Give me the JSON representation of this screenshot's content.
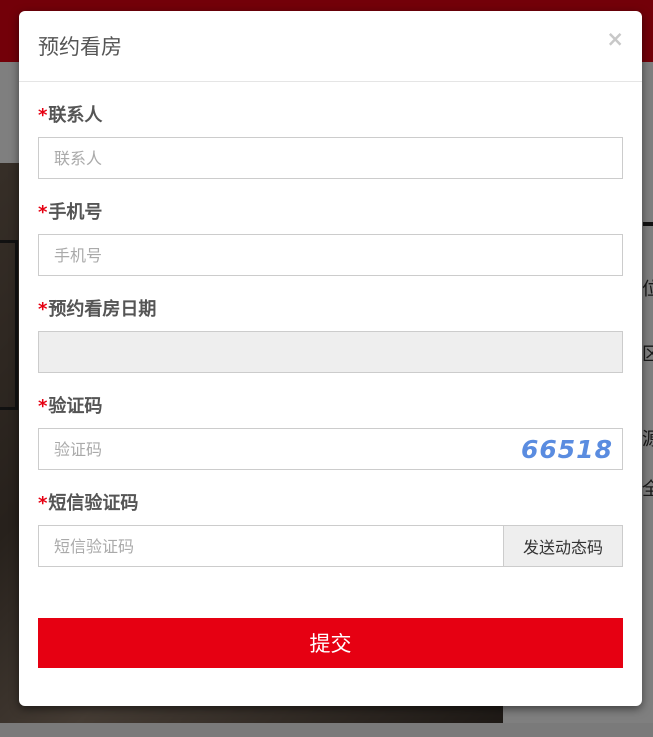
{
  "modal": {
    "title": "预约看房",
    "close_glyph": "×"
  },
  "form": {
    "required_mark": "*",
    "contact": {
      "label": "联系人",
      "placeholder": "联系人"
    },
    "phone": {
      "label": "手机号",
      "placeholder": "手机号"
    },
    "date": {
      "label": "预约看房日期",
      "value": ""
    },
    "captcha": {
      "label": "验证码",
      "placeholder": "验证码",
      "code": "66518"
    },
    "sms": {
      "label": "短信验证码",
      "placeholder": "短信验证码",
      "send_button": "发送动态码"
    },
    "submit_label": "提交"
  },
  "background": {
    "side_chars": [
      "位",
      "区",
      "源",
      "全"
    ]
  },
  "colors": {
    "accent": "#e60012",
    "captcha": "#5a8ce0",
    "label": "#555555"
  },
  "icons": {
    "close": "close-icon"
  }
}
